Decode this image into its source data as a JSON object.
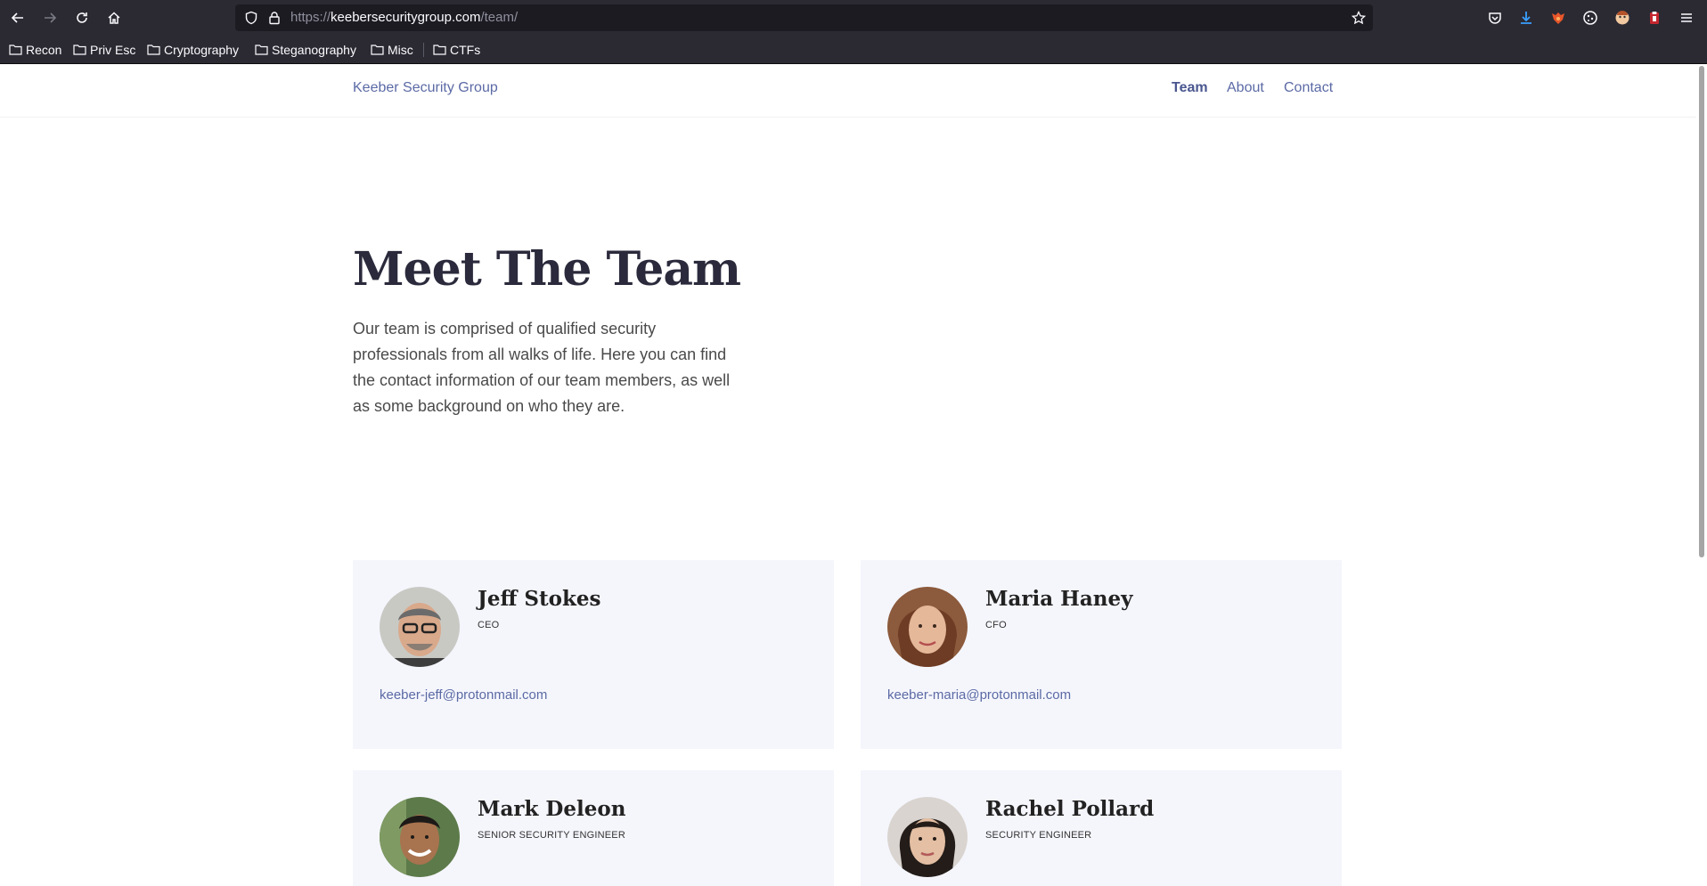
{
  "browser": {
    "url_scheme": "https://",
    "url_domain": "keebersecuritygroup.com",
    "url_path": "/team/",
    "bookmarks": [
      "Recon",
      "Priv Esc",
      "Cryptography",
      "Steganography",
      "Misc",
      "CTFs"
    ]
  },
  "site": {
    "brand": "Keeber Security Group",
    "nav": [
      "Team",
      "About",
      "Contact"
    ],
    "active_nav": "Team"
  },
  "hero": {
    "title": "Meet The Team",
    "text": "Our team is comprised of qualified security professionals from all walks of life. Here you can find the contact information of our team members, as well as some background on who they are."
  },
  "team": [
    {
      "name": "Jeff Stokes",
      "role": "CEO",
      "email": "keeber-jeff@protonmail.com"
    },
    {
      "name": "Maria Haney",
      "role": "CFO",
      "email": "keeber-maria@protonmail.com"
    },
    {
      "name": "Mark Deleon",
      "role": "SENIOR SECURITY ENGINEER",
      "email": ""
    },
    {
      "name": "Rachel Pollard",
      "role": "SECURITY ENGINEER",
      "email": ""
    }
  ],
  "colors": {
    "chrome": "#2b2a33",
    "link": "#5b6aa5",
    "card_bg": "#f5f6fc",
    "heading": "#2a2a3c"
  }
}
